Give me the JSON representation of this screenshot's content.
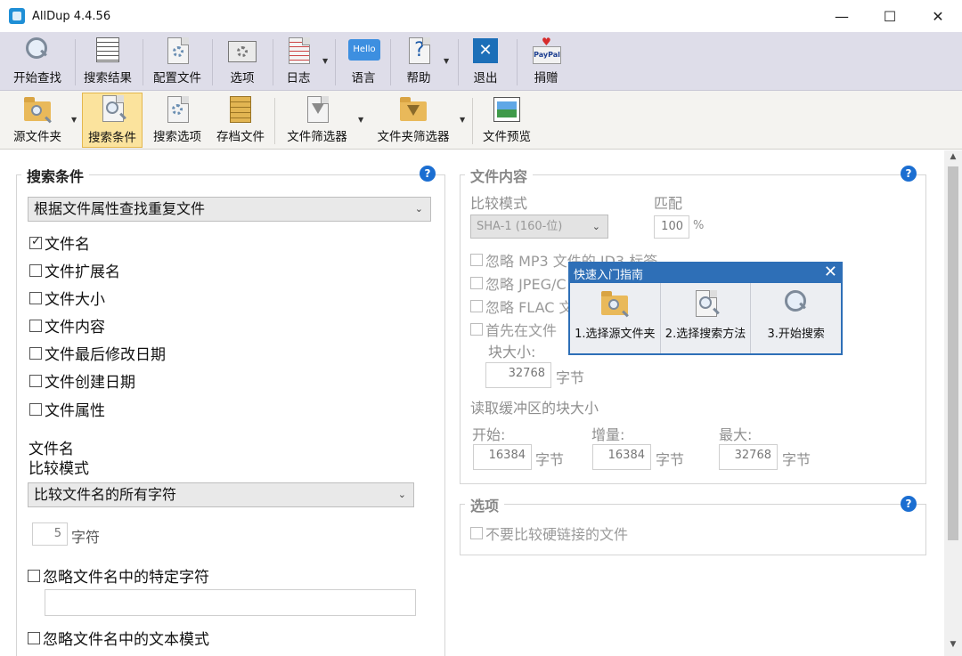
{
  "window": {
    "title": "AllDup 4.4.56",
    "minimize": "—",
    "maximize": "☐",
    "close": "✕"
  },
  "toolbar_main": [
    {
      "label": "开始查找",
      "icon": "magnifier-icon"
    },
    {
      "label": "搜索结果",
      "icon": "results-grid-icon"
    },
    {
      "label": "配置文件",
      "icon": "profile-gear-icon"
    },
    {
      "label": "选项",
      "icon": "options-gear-icon"
    },
    {
      "label": "日志",
      "icon": "log-document-icon"
    },
    {
      "label": "语言",
      "icon": "hello-bubble-icon",
      "icon_text": "Hello"
    },
    {
      "label": "帮助",
      "icon": "help-question-icon",
      "icon_text": "?"
    },
    {
      "label": "退出",
      "icon": "exit-x-icon",
      "icon_text": "✕"
    },
    {
      "label": "捐赠",
      "icon": "paypal-heart-icon",
      "icon_text": "PayPal"
    }
  ],
  "toolbar_sub": [
    {
      "label": "源文件夹",
      "icon": "source-folder-icon"
    },
    {
      "label": "搜索条件",
      "icon": "search-criteria-icon",
      "active": true
    },
    {
      "label": "搜索选项",
      "icon": "search-options-icon"
    },
    {
      "label": "存档文件",
      "icon": "archive-file-icon"
    },
    {
      "label": "文件筛选器",
      "icon": "file-filter-icon"
    },
    {
      "label": "文件夹筛选器",
      "icon": "folder-filter-icon"
    },
    {
      "label": "文件预览",
      "icon": "file-preview-icon"
    }
  ],
  "search_criteria": {
    "title": "搜索条件",
    "mode_select": "根据文件属性查找重复文件",
    "checks": [
      {
        "label": "文件名",
        "checked": true
      },
      {
        "label": "文件扩展名",
        "checked": false
      },
      {
        "label": "文件大小",
        "checked": false
      },
      {
        "label": "文件内容",
        "checked": false
      },
      {
        "label": "文件最后修改日期",
        "checked": false
      },
      {
        "label": "文件创建日期",
        "checked": false
      },
      {
        "label": "文件属性",
        "checked": false
      }
    ],
    "filename_label": "文件名",
    "compare_mode_label": "比较模式",
    "compare_select": "比较文件名的所有字符",
    "char_count": "5",
    "char_unit": "字符",
    "ignore_chars_label": "忽略文件名中的特定字符",
    "ignore_pattern_label": "忽略文件名中的文本模式"
  },
  "file_content": {
    "title": "文件内容",
    "compare_mode_label": "比较模式",
    "match_label": "匹配",
    "algo_select": "SHA-1 (160-位)",
    "match_value": "100",
    "match_unit": "%",
    "ignore_mp3": "忽略 MP3 文件的 ID3 标签",
    "ignore_jpeg": "忽略 JPEG/C",
    "ignore_flac": "忽略 FLAC 文",
    "first_compare": "首先在文件",
    "block_size_label": "块大小:",
    "block_size_value": "32768",
    "byte_unit": "字节",
    "buffer_label": "读取缓冲区的块大小",
    "start_label": "开始:",
    "start_value": "16384",
    "inc_label": "增量:",
    "inc_value": "16384",
    "max_label": "最大:",
    "max_value": "32768"
  },
  "options": {
    "title": "选项",
    "hardlink_label": "不要比较硬链接的文件"
  },
  "quick_start": {
    "title": "快速入门指南",
    "close": "✕",
    "steps": [
      "1.选择源文件夹",
      "2.选择搜索方法",
      "3.开始搜索"
    ]
  },
  "scroll": {
    "up": "▲",
    "down": "▼"
  },
  "colors": {
    "accent": "#2e6fb7",
    "help": "#1b6ed1",
    "active_tab": "#fbe39d",
    "toolbar_bg": "#dedde9"
  }
}
